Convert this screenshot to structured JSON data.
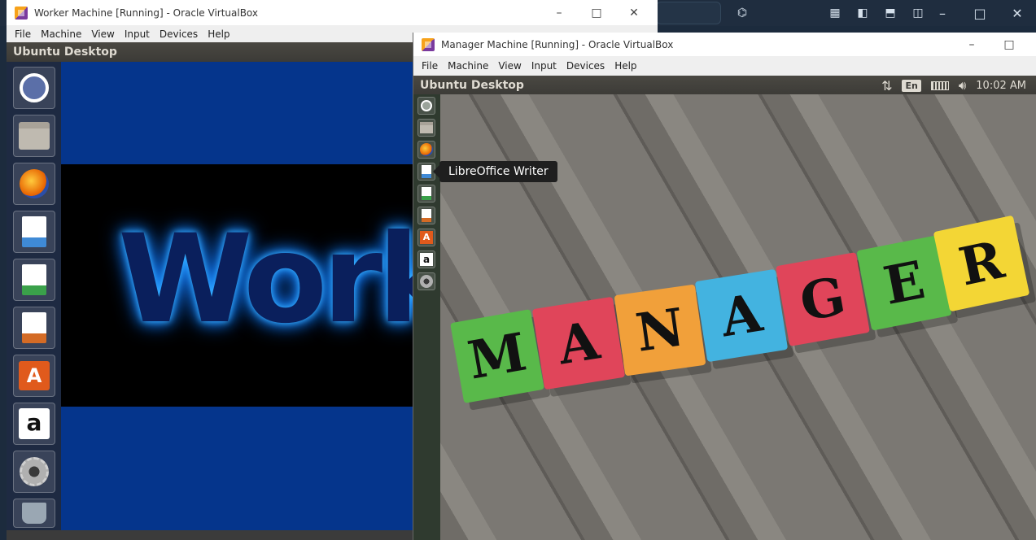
{
  "host": {
    "controls": [
      "–",
      "□",
      "✕"
    ]
  },
  "worker": {
    "title": "Worker Machine [Running] - Oracle VirtualBox",
    "menu": [
      "File",
      "Machine",
      "View",
      "Input",
      "Devices",
      "Help"
    ],
    "top_panel_title": "Ubuntu Desktop",
    "wallpaper_text": "Work",
    "launcher": [
      {
        "name": "ubuntu-dash-icon",
        "color": "#5b6fa8"
      },
      {
        "name": "files-icon",
        "color": "#bfbab0"
      },
      {
        "name": "firefox-icon",
        "color": "#e66000"
      },
      {
        "name": "libreoffice-writer-icon",
        "color": "#3f8ad6"
      },
      {
        "name": "libreoffice-calc-icon",
        "color": "#3aa14a"
      },
      {
        "name": "libreoffice-impress-icon",
        "color": "#d46b25"
      },
      {
        "name": "ubuntu-software-icon",
        "color": "#e05a1c"
      },
      {
        "name": "amazon-icon",
        "color": "#ffffff"
      },
      {
        "name": "system-settings-icon",
        "color": "#b0b0b0"
      },
      {
        "name": "trash-icon",
        "color": "#9aa7b3"
      }
    ],
    "window_controls": [
      "–",
      "□",
      "✕"
    ]
  },
  "manager": {
    "title": "Manager Machine [Running] - Oracle VirtualBox",
    "menu": [
      "File",
      "Machine",
      "View",
      "Input",
      "Devices",
      "Help"
    ],
    "top_panel_title": "Ubuntu Desktop",
    "keyboard_layout": "En",
    "clock": "10:02 AM",
    "tooltip": "LibreOffice Writer",
    "window_controls": [
      "–",
      "□"
    ],
    "launcher": [
      {
        "name": "ubuntu-dash-icon",
        "color": "#9aa39a"
      },
      {
        "name": "files-icon",
        "color": "#bfbab0"
      },
      {
        "name": "firefox-icon",
        "color": "#e66000"
      },
      {
        "name": "libreoffice-writer-icon",
        "color": "#3f8ad6"
      },
      {
        "name": "libreoffice-calc-icon",
        "color": "#3aa14a"
      },
      {
        "name": "libreoffice-impress-icon",
        "color": "#d46b25"
      },
      {
        "name": "ubuntu-software-icon",
        "color": "#e05a1c"
      },
      {
        "name": "amazon-icon",
        "color": "#ffffff"
      },
      {
        "name": "system-settings-icon",
        "color": "#b0b0b0"
      }
    ],
    "cubes": [
      {
        "letter": "M",
        "color": "#59b94a"
      },
      {
        "letter": "A",
        "color": "#e0455a"
      },
      {
        "letter": "N",
        "color": "#f1a03a"
      },
      {
        "letter": "A",
        "color": "#43b3e0"
      },
      {
        "letter": "G",
        "color": "#e0455a"
      },
      {
        "letter": "E",
        "color": "#59b94a"
      },
      {
        "letter": "R",
        "color": "#f3d635"
      }
    ]
  }
}
